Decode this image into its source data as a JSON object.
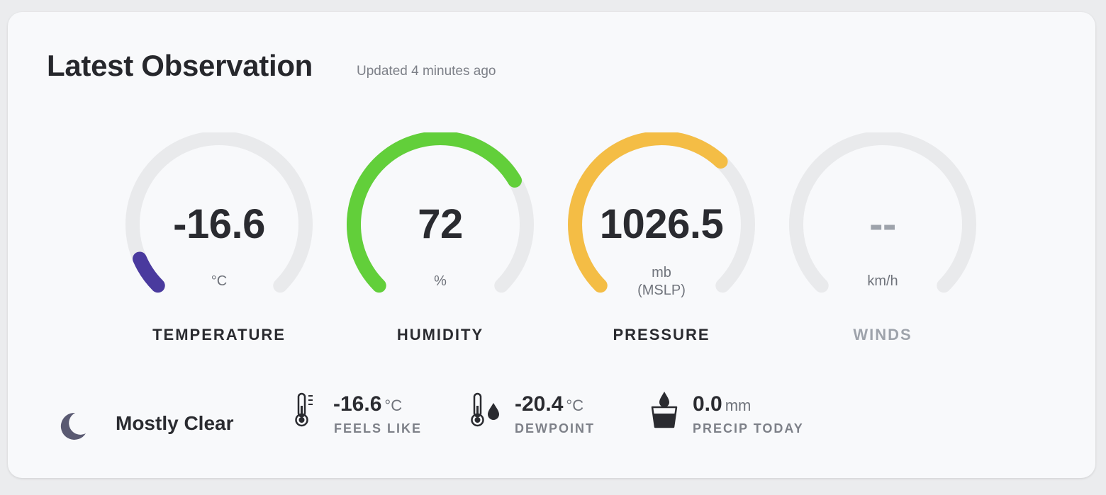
{
  "header": {
    "title": "Latest Observation",
    "updated": "Updated 4 minutes ago"
  },
  "gauges": [
    {
      "value": "-16.6",
      "unit": "°C",
      "label": "TEMPERATURE",
      "fraction": 0.08,
      "color": "#4a3a9e"
    },
    {
      "value": "72",
      "unit": "%",
      "label": "HUMIDITY",
      "fraction": 0.72,
      "color": "#62cf3a"
    },
    {
      "value": "1026.5",
      "unit": "mb",
      "unit2": "(MSLP)",
      "label": "PRESSURE",
      "fraction": 0.66,
      "color": "#f4bd45"
    },
    {
      "value": "--",
      "unit": "km/h",
      "label": "WINDS",
      "fraction": 0,
      "color": "#e9eaec"
    }
  ],
  "conditions": {
    "icon": "moon-icon",
    "text": "Mostly Clear"
  },
  "stats": [
    {
      "icon": "thermometer-icon",
      "value": "-16.6",
      "unit": "°C",
      "label": "FEELS LIKE"
    },
    {
      "icon": "dewpoint-icon",
      "value": "-20.4",
      "unit": "°C",
      "label": "DEWPOINT"
    },
    {
      "icon": "precip-cup-icon",
      "value": "0.0",
      "unit": "mm",
      "label": "PRECIP TODAY"
    }
  ],
  "colors": {
    "track": "#e9eaec",
    "text_dark": "#2a2b30",
    "text_muted": "#9ea3ab"
  }
}
